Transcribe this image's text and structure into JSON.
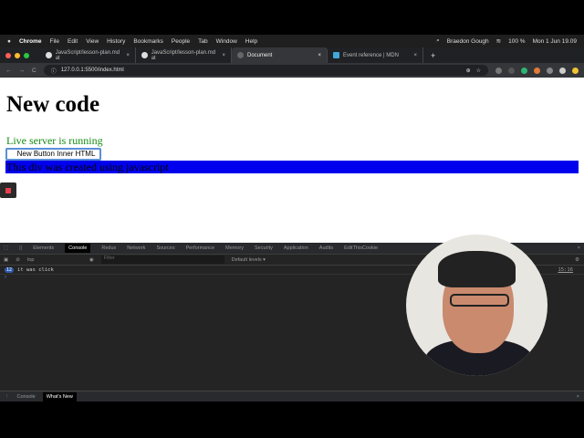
{
  "menubar": {
    "apple": "",
    "app": "Chrome",
    "items": [
      "File",
      "Edit",
      "View",
      "History",
      "Bookmarks",
      "People",
      "Tab",
      "Window",
      "Help"
    ],
    "user": "Braedon Gough",
    "battery": "100 %",
    "datetime": "Mon 1 Jun  19.09"
  },
  "tabs": [
    {
      "label": "JavaScript/lesson-plan.md at",
      "close": "×"
    },
    {
      "label": "JavaScript/lesson-plan.md at",
      "close": "×"
    },
    {
      "label": "Document",
      "close": "×"
    },
    {
      "label": "Event reference | MDN",
      "close": "×"
    }
  ],
  "new_tab": "+",
  "address": {
    "url": "127.0.0.1:5500/index.html",
    "back": "←",
    "forward": "→",
    "reload": "C",
    "info": "ⓘ",
    "zoom": "⊕",
    "star": "☆"
  },
  "page": {
    "heading": "New code",
    "live_text": "Live server is running",
    "button_label": "New Button Inner HTML",
    "div_text": "This div was created using javascript"
  },
  "devtools": {
    "tabs": [
      "Elements",
      "Console",
      "Redux",
      "Network",
      "Sources",
      "Performance",
      "Memory",
      "Security",
      "Application",
      "Audits",
      "EditThisCookie"
    ],
    "context": "top",
    "filter_placeholder": "Filter",
    "levels": "Default levels ▾",
    "log": {
      "count": "12",
      "message": "it was click",
      "source": "15:16"
    },
    "prompt": "›",
    "drawer_tabs": [
      "Console",
      "What's New"
    ],
    "close": "×"
  }
}
